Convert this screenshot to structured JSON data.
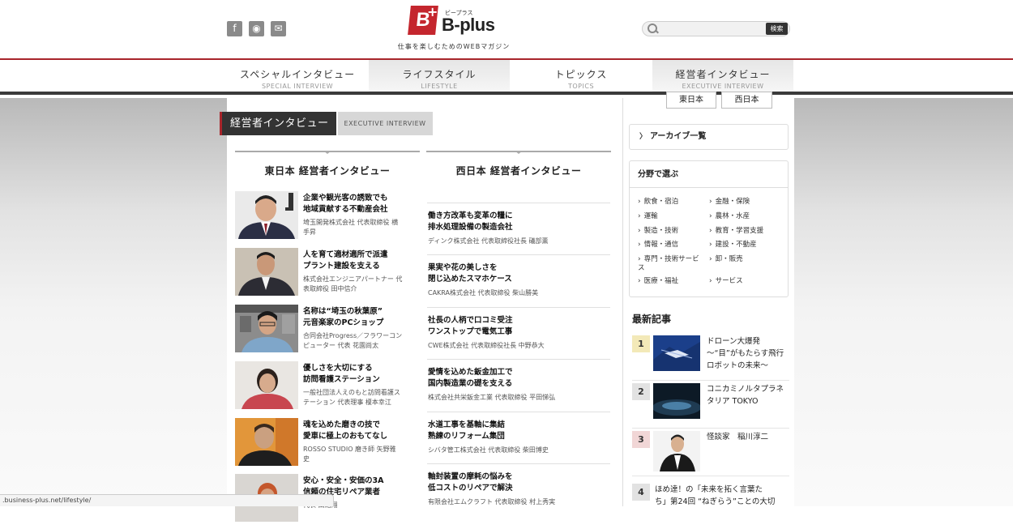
{
  "header": {
    "logo_text": "B-plus",
    "logo_kana": "ビープラス",
    "tagline": "仕事を楽しむためのWEBマガジン",
    "search_placeholder": "",
    "search_button": "検索",
    "social": [
      {
        "icon": "facebook-icon",
        "glyph": "f"
      },
      {
        "icon": "rss-icon",
        "glyph": "◉"
      },
      {
        "icon": "mail-icon",
        "glyph": "✉"
      }
    ]
  },
  "nav": [
    {
      "jp": "スペシャルインタビュー",
      "en": "SPECIAL INTERVIEW"
    },
    {
      "jp": "ライフスタイル",
      "en": "LIFESTYLE"
    },
    {
      "jp": "トピックス",
      "en": "TOPICS"
    },
    {
      "jp": "経営者インタビュー",
      "en": "EXECUTIVE INTERVIEW"
    }
  ],
  "subnav": [
    "東日本",
    "西日本"
  ],
  "section": {
    "jp": "経営者インタビュー",
    "en": "EXECUTIVE INTERVIEW"
  },
  "east": {
    "heading": "東日本 経営者インタビュー",
    "items": [
      {
        "title1": "企業や観光客の誘致でも",
        "title2": "地域貢献する不動産会社",
        "by1": "埼玉開発株式会社 代表取締役 横",
        "by2": "手昇"
      },
      {
        "title1": "人を育て適材適所で派遣",
        "title2": "プラント建設を支える",
        "by1": "株式会社エンジニアパートナー 代",
        "by2": "表取締役 田中信介"
      },
      {
        "title1": "名称は“埼玉の秋葉原”",
        "title2": "元音楽家のPCショップ",
        "by1": "合同会社Progress／フラワーコン",
        "by2": "ピューター 代表 花園尚太"
      },
      {
        "title1": "優しさを大切にする",
        "title2": "訪問看護ステーション",
        "by1": "一般社団法人えのもと訪問看護ス",
        "by2": "テーション 代表理事 榎本幸江"
      },
      {
        "title1": "魂を込めた磨きの技で",
        "title2": "愛車に極上のおもてなし",
        "by1": "ROSSO STUDIO 磨き師 矢野雅",
        "by2": "史"
      },
      {
        "title1": "安心・安全・安価の3A",
        "title2": "信頼の住宅リペア業者",
        "by1": "代表 田緒翔",
        "by2": ""
      }
    ]
  },
  "west": {
    "heading": "西日本 経営者インタビュー",
    "items": [
      {
        "title1": "働き方改革も変革の糧に",
        "title2": "排水処理設備の製造会社",
        "by": "ディンク株式会社 代表取締役社長 礒部薫"
      },
      {
        "title1": "果実や花の美しさを",
        "title2": "閉じ込めたスマホケース",
        "by": "CAKRA株式会社 代表取締役 柴山勝美"
      },
      {
        "title1": "社長の人柄で口コミ受注",
        "title2": "ワンストップで電気工事",
        "by": "CWE株式会社 代表取締役社長 中野恭大"
      },
      {
        "title1": "愛情を込めた鈑金加工で",
        "title2": "国内製造業の礎を支える",
        "by": "株式会社共栄鈑金工業 代表取締役 平田悌弘"
      },
      {
        "title1": "水道工事を基軸に集結",
        "title2": "熟練のリフォーム集団",
        "by": "シバタ管工株式会社 代表取締役 柴田博史"
      },
      {
        "title1": "軸封装置の摩耗の悩みを",
        "title2": "低コストのリペアで解決",
        "by": "有限会社エムクラフト 代表取締役 村上秀実"
      }
    ]
  },
  "sidebar": {
    "archive": "アーカイブ一覧",
    "genre_heading": "分野で選ぶ",
    "genres_left": [
      "飲食・宿泊",
      "運輸",
      "製造・技術",
      "情報・通信",
      "専門・技術サービ",
      "医療・福祉"
    ],
    "genre_wrap": "ス",
    "genres_right": [
      "金融・保険",
      "農林・水産",
      "教育・学習支援",
      "建設・不動産",
      "卸・販売",
      "サービス"
    ],
    "latest_heading": "最新記事",
    "latest": [
      {
        "rank": "1",
        "line1": "ドローン大爆発",
        "line2": "〜“目”がもたらす飛行",
        "line3": "ロボットの未来〜",
        "color": "#f3e9b8"
      },
      {
        "rank": "2",
        "line1": "コニカミノルタプラネ",
        "line2": "タリア TOKYO",
        "line3": "",
        "color": "#e2e2e2"
      },
      {
        "rank": "3",
        "line1": "怪談家　稲川淳二",
        "line2": "",
        "line3": "",
        "color": "#f1d6d6"
      },
      {
        "rank": "4",
        "line1": "ほめ達！の「未来を拓く言葉た",
        "line2": "ち」第24回 “ねぎらう”ことの大切",
        "line3": "",
        "color": "#e2e2e2"
      }
    ]
  },
  "status_url": ".business-plus.net/lifestyle/"
}
